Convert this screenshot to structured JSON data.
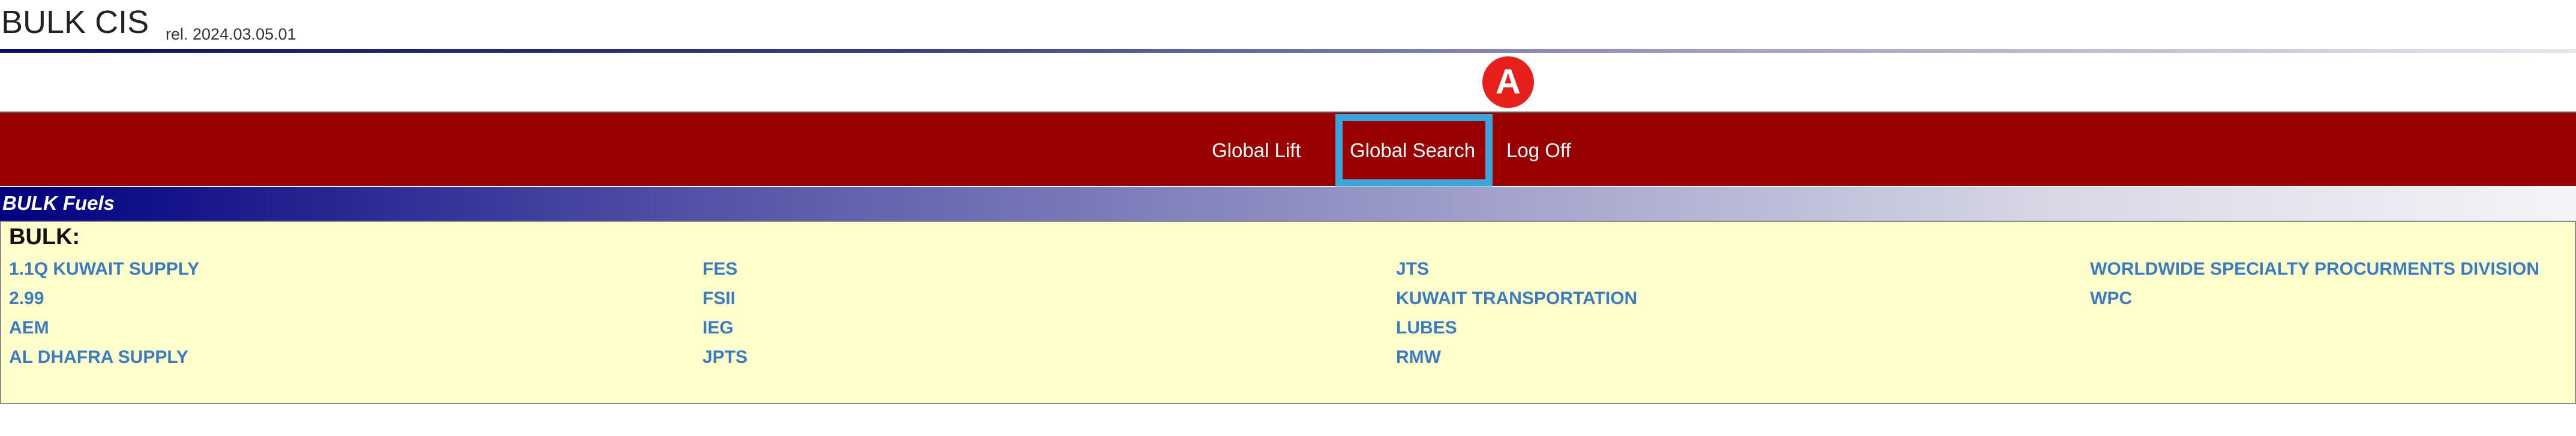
{
  "app": {
    "title": "BULK CIS",
    "release": "rel. 2024.03.05.01"
  },
  "nav": {
    "items": [
      "Global Lift",
      "Global Search",
      "Log Off"
    ]
  },
  "annotation": {
    "label": "A",
    "color": "#e8201c",
    "highlight_color": "#3aa6dc"
  },
  "section": {
    "title": "BULK Fuels"
  },
  "panel": {
    "heading": "BULK:",
    "columns": [
      [
        "1.1Q KUWAIT SUPPLY",
        "2.99",
        "AEM",
        "AL DHAFRA SUPPLY"
      ],
      [
        "FES",
        "FSII",
        "IEG",
        "JPTS"
      ],
      [
        "JTS",
        "KUWAIT TRANSPORTATION",
        "LUBES",
        "RMW"
      ],
      [
        "WORLDWIDE SPECIALTY PROCURMENTS DIVISION",
        "WPC"
      ]
    ]
  },
  "colors": {
    "navbar": "#990000",
    "panel_bg": "#ffffcc",
    "link": "#3a7cc4"
  }
}
